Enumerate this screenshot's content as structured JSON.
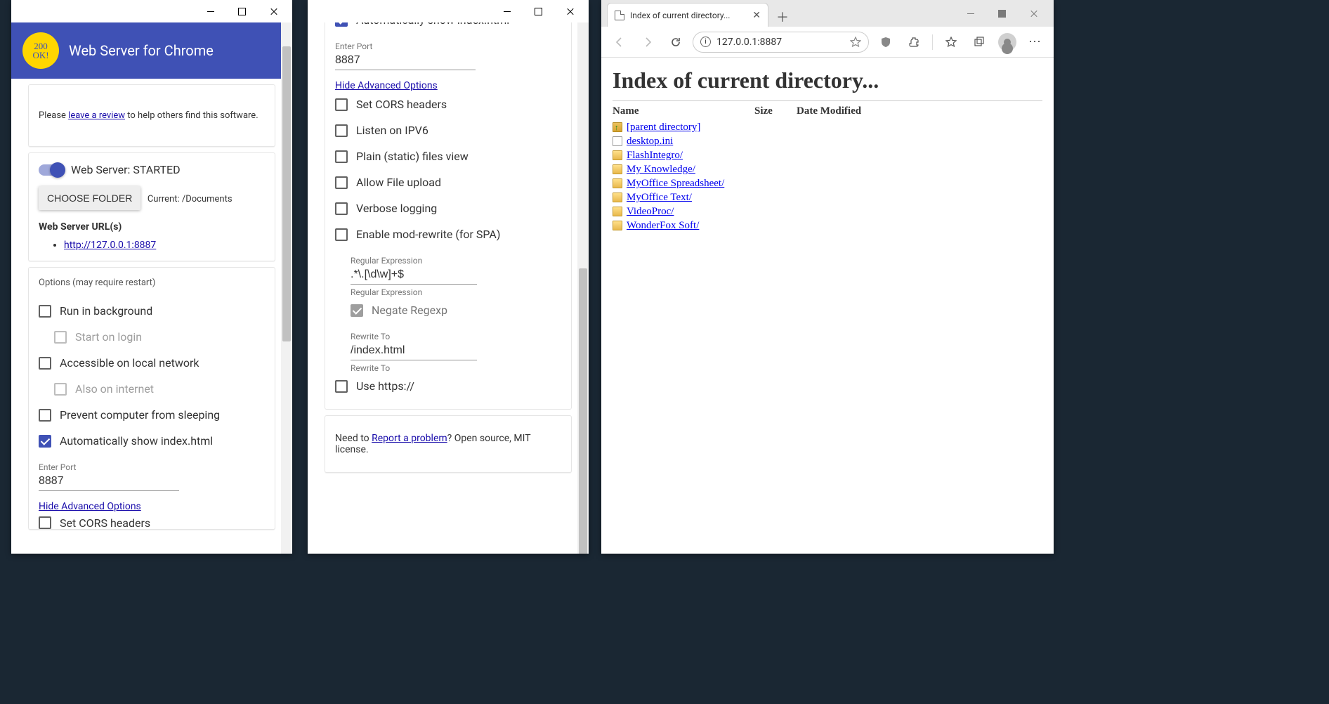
{
  "app": {
    "title": "Web Server for Chrome",
    "logo_text": "200\nOK!",
    "review_prefix": "Please ",
    "review_link": "leave a review",
    "review_suffix": " to help others find this software.",
    "status_label": "Web Server: STARTED",
    "choose_folder": "CHOOSE FOLDER",
    "current_path": "Current: /Documents",
    "urls_heading": "Web Server URL(s)",
    "url": "http://127.0.0.1:8887",
    "options_heading": "Options (may require restart)",
    "opts": {
      "run_bg": "Run in background",
      "start_login": "Start on login",
      "local_net": "Accessible on local network",
      "also_inet": "Also on internet",
      "prevent_sleep": "Prevent computer from sleeping",
      "auto_index": "Automatically show index.html",
      "port_label": "Enter Port",
      "port_value": "8887",
      "hide_adv": "Hide Advanced Options",
      "cors": "Set CORS headers",
      "ipv6": "Listen on IPV6",
      "static_view": "Plain (static) files view",
      "upload": "Allow File upload",
      "verbose": "Verbose logging",
      "rewrite": "Enable mod-rewrite (for SPA)",
      "regex_label": "Regular Expression",
      "regex_value": ".*\\.[\\d\\w]+$",
      "negate": "Negate Regexp",
      "rewrite_to_label": "Rewrite To",
      "rewrite_to_value": "/index.html",
      "https": "Use https://"
    },
    "footer_prefix": "Need to ",
    "footer_link": "Report a problem",
    "footer_suffix": "? Open source, MIT license."
  },
  "browser": {
    "tab_title": "Index of current directory...",
    "url": "127.0.0.1:8887",
    "page_heading": "Index of current directory...",
    "col_name": "Name",
    "col_size": "Size",
    "col_date": "Date Modified",
    "entries": {
      "parent": "[parent directory]",
      "e0": "desktop.ini",
      "e1": "FlashIntegro/",
      "e2": "My Knowledge/",
      "e3": "MyOffice Spreadsheet/",
      "e4": "MyOffice Text/",
      "e5": "VideoProc/",
      "e6": "WonderFox Soft/"
    }
  }
}
